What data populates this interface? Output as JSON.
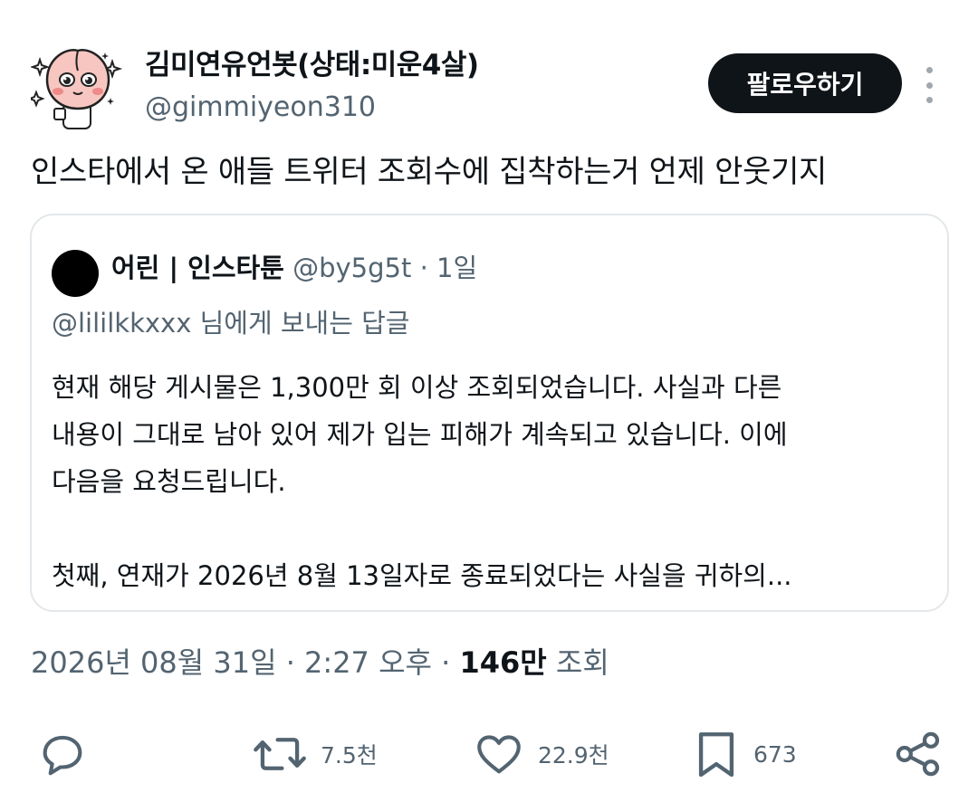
{
  "author": {
    "display_name": "김미연유언봇(상태:미운4살)",
    "handle": "@gimmiyeon310",
    "avatar_icon": "peach-character-avatar"
  },
  "follow_button": {
    "label": "팔로우하기"
  },
  "more_button": {
    "icon": "more-vertical-icon"
  },
  "tweet": {
    "text": "인스타에서 온 애들 트위터 조회수에 집착하는거 언제 안웃기지"
  },
  "quote": {
    "name": "어린 | 인스타툰",
    "handle": "@by5g5t",
    "separator": "·",
    "time": "1일",
    "reply_to": "@lililkkxxx 님에게 보내는 답글",
    "body_lines": [
      "현재 해당 게시물은 1,300만 회 이상 조회되었습니다. 사실과 다른",
      "내용이 그대로 남아 있어 제가 입는 피해가 계속되고 있습니다. 이에",
      "다음을 요청드립니다.",
      "첫째, 연재가 2026년 8월 13일자로 종료되었다는 사실을 귀하의..."
    ]
  },
  "meta": {
    "datetime": "2026년 08월 31일 · 2:27 오후 ·",
    "views_count": "146만",
    "views_label": "조회"
  },
  "actions": {
    "reply": {
      "icon": "reply-icon"
    },
    "retweet": {
      "icon": "retweet-icon",
      "count": "7.5천"
    },
    "like": {
      "icon": "heart-icon",
      "count": "22.9천"
    },
    "bookmark": {
      "icon": "bookmark-icon",
      "count": "673"
    },
    "share": {
      "icon": "share-icon"
    }
  },
  "colors": {
    "text_primary": "#0f1419",
    "text_secondary": "#536471",
    "button_bg": "#0f1419",
    "border": "#e3e7ea"
  }
}
